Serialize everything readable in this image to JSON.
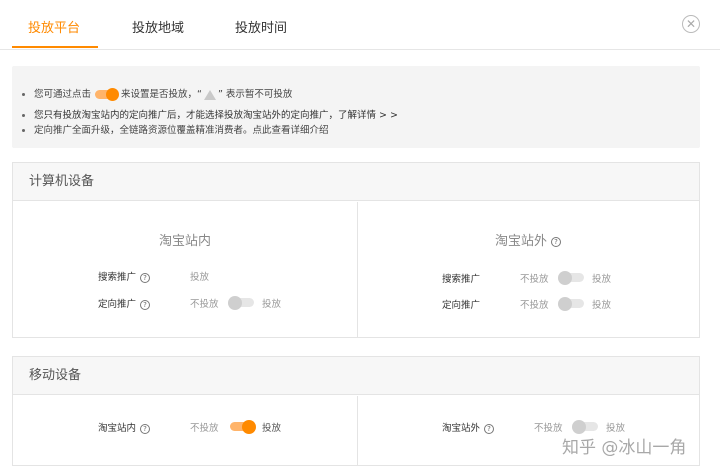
{
  "tabs": [
    {
      "label": "投放平台",
      "active": true
    },
    {
      "label": "投放地域",
      "active": false
    },
    {
      "label": "投放时间",
      "active": false
    }
  ],
  "close_icon": "close-circle-icon",
  "notice": {
    "line1_pre": "您可通过点击",
    "line1_post": "来设置是否投放，“",
    "line1_end": "” 表示暂不可投放",
    "line2": "您只有投放淘宝站内的定向推广后，才能选择投放淘宝站外的定向推广，了解详情 > >",
    "line3": "定向推广全面升级，全链路资源位覆盖精准消费者。点此查看详细介绍"
  },
  "computer": {
    "title": "计算机设备",
    "inside": {
      "title": "淘宝站内",
      "rows": [
        {
          "label": "搜索推广",
          "off_text": "",
          "on_text": "投放",
          "has_toggle": false
        },
        {
          "label": "定向推广",
          "off_text": "不投放",
          "on_text": "投放",
          "toggle_on": false
        }
      ]
    },
    "outside": {
      "title": "淘宝站外",
      "rows": [
        {
          "label": "搜索推广",
          "off_text": "不投放",
          "on_text": "投放",
          "toggle_on": false
        },
        {
          "label": "定向推广",
          "off_text": "不投放",
          "on_text": "投放",
          "toggle_on": false
        }
      ]
    }
  },
  "mobile": {
    "title": "移动设备",
    "inside": {
      "label": "淘宝站内",
      "off_text": "不投放",
      "on_text": "投放",
      "toggle_on": true
    },
    "outside": {
      "label": "淘宝站外",
      "off_text": "不投放",
      "on_text": "投放",
      "toggle_on": false
    }
  },
  "watermark": "知乎 @冰山一角",
  "colors": {
    "accent": "#ff8a00",
    "accent_light": "#ffb46a",
    "toggle_off": "#cfcfcf"
  }
}
